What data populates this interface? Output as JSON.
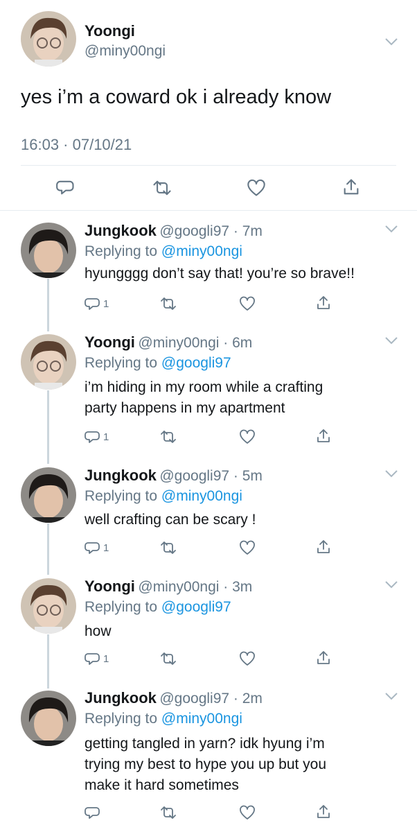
{
  "main_tweet": {
    "name": "Yoongi",
    "handle": "@miny00ngi",
    "text": "yes i’m a coward ok i already know",
    "timestamp": "16:03 · 07/10/21"
  },
  "replies": [
    {
      "name": "Jungkook",
      "meta": "@googli97 · 7m",
      "reply_prefix": "Replying to",
      "reply_to": "@miny00ngi",
      "text_lines": [
        "hyungggg don’t say that! you’re so brave!!"
      ],
      "reply_count": "1"
    },
    {
      "name": "Yoongi",
      "meta": "@miny00ngi · 6m",
      "reply_prefix": "Replying to",
      "reply_to": "@googli97",
      "text_lines": [
        "i’m hiding in my room while a crafting",
        "party happens in my apartment"
      ],
      "reply_count": "1"
    },
    {
      "name": "Jungkook",
      "meta": "@googli97 · 5m",
      "reply_prefix": "Replying to",
      "reply_to": "@miny00ngi",
      "text_lines": [
        "well crafting can be scary !"
      ],
      "reply_count": "1"
    },
    {
      "name": "Yoongi",
      "meta": "@miny00ngi · 3m",
      "reply_prefix": "Replying to",
      "reply_to": "@googli97",
      "text_lines": [
        "how"
      ],
      "reply_count": "1"
    },
    {
      "name": "Jungkook",
      "meta": "@googli97 · 2m",
      "reply_prefix": "Replying to",
      "reply_to": "@miny00ngi",
      "text_lines": [
        "getting tangled in yarn? idk hyung i’m",
        "trying my best to hype you up but you",
        "make it hard sometimes"
      ],
      "reply_count": ""
    }
  ],
  "colors": {
    "link_blue": "#1b95e0",
    "secondary_gray": "#657786",
    "divider": "#e6ecf0"
  },
  "icons": [
    "reply-icon",
    "retweet-icon",
    "like-icon",
    "share-icon",
    "chevron-down-icon"
  ]
}
